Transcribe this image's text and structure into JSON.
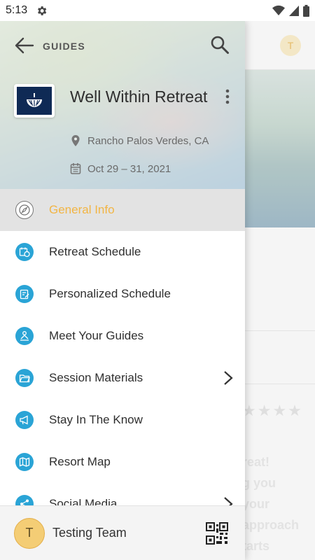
{
  "status_bar": {
    "time": "5:13",
    "icons": [
      "settings-gear-icon",
      "wifi-icon",
      "cellular-signal-icon",
      "battery-icon"
    ]
  },
  "background_app": {
    "avatar_initial": "T",
    "rating_stars": "★★★★",
    "text_lines": [
      "reat!",
      "g you",
      "your",
      "approach",
      "tarts"
    ]
  },
  "drawer": {
    "header": {
      "section_label": "GUIDES",
      "event_title": "Well Within Retreat",
      "location": "Rancho Palos Verdes, CA",
      "dates": "Oct 29 – 31, 2021"
    },
    "menu": [
      {
        "label": "General Info",
        "icon": "compass-icon",
        "active": true,
        "chevron": false
      },
      {
        "label": "Retreat Schedule",
        "icon": "calendar-clock-icon",
        "active": false,
        "chevron": false
      },
      {
        "label": "Personalized Schedule",
        "icon": "clipboard-edit-icon",
        "active": false,
        "chevron": false
      },
      {
        "label": "Meet Your Guides",
        "icon": "presenter-icon",
        "active": false,
        "chevron": false
      },
      {
        "label": "Session Materials",
        "icon": "folder-open-icon",
        "active": false,
        "chevron": true
      },
      {
        "label": "Stay In The Know",
        "icon": "megaphone-icon",
        "active": false,
        "chevron": false
      },
      {
        "label": "Resort Map",
        "icon": "map-icon",
        "active": false,
        "chevron": false
      },
      {
        "label": "Social Media",
        "icon": "share-icon",
        "active": false,
        "chevron": true
      }
    ],
    "footer": {
      "user_initial": "T",
      "user_name": "Testing Team"
    }
  },
  "colors": {
    "accent_active": "#f2b544",
    "menu_icon_blue": "#2aa4d6",
    "avatar_yellow": "#f4cd75",
    "logo_navy": "#0f2a55"
  }
}
